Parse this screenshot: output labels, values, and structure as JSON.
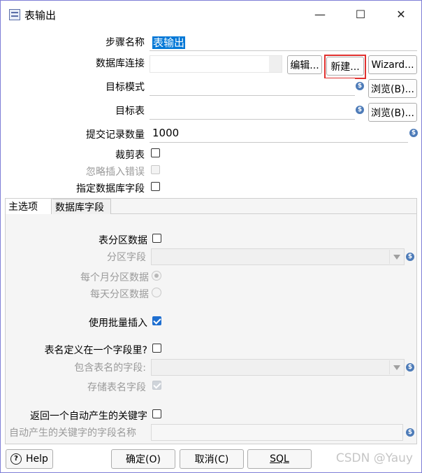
{
  "window": {
    "title": "表输出",
    "minimize_glyph": "—",
    "maximize_glyph": "☐",
    "close_glyph": "✕"
  },
  "form": {
    "step_name_label": "步骤名称",
    "step_name_value": "表输出",
    "db_conn_label": "数据库连接",
    "db_conn_value": "",
    "edit_button": "编辑...",
    "new_button": "新建...",
    "wizard_button": "Wizard...",
    "target_schema_label": "目标模式",
    "target_schema_value": "",
    "browse_schema_button": "浏览(B)...",
    "target_table_label": "目标表",
    "target_table_value": "",
    "browse_table_button": "浏览(B)...",
    "commit_size_label": "提交记录数量",
    "commit_size_value": "1000",
    "truncate_label": "裁剪表",
    "ignore_errors_label": "忽略插入错误",
    "specify_fields_label": "指定数据库字段"
  },
  "tabs": [
    {
      "label": "主选项"
    },
    {
      "label": "数据库字段"
    }
  ],
  "main_tab": {
    "partition_label": "表分区数据",
    "partition_field_label": "分区字段",
    "partition_field_value": "",
    "monthly_label": "每个月分区数据",
    "daily_label": "每天分区数据",
    "batch_insert_label": "使用批量插入",
    "tablename_in_field_label": "表名定义在一个字段里?",
    "tablename_field_label": "包含表名的字段:",
    "tablename_field_value": "",
    "store_tablename_label": "存储表名字段",
    "return_key_label": "返回一个自动产生的关键字",
    "key_field_label": "自动产生的关键字的字段名称",
    "key_field_value": ""
  },
  "buttons": {
    "help": "Help",
    "ok": "确定(O)",
    "cancel": "取消(C)",
    "sql": "SQL"
  },
  "variable_icon_glyph": "$",
  "watermark": "CSDN @Yauy",
  "colors": {
    "accent": "#1f6fd0",
    "selection": "#0078d7",
    "highlight_border": "#e0302e",
    "variable_icon": "#4d7bb8"
  }
}
